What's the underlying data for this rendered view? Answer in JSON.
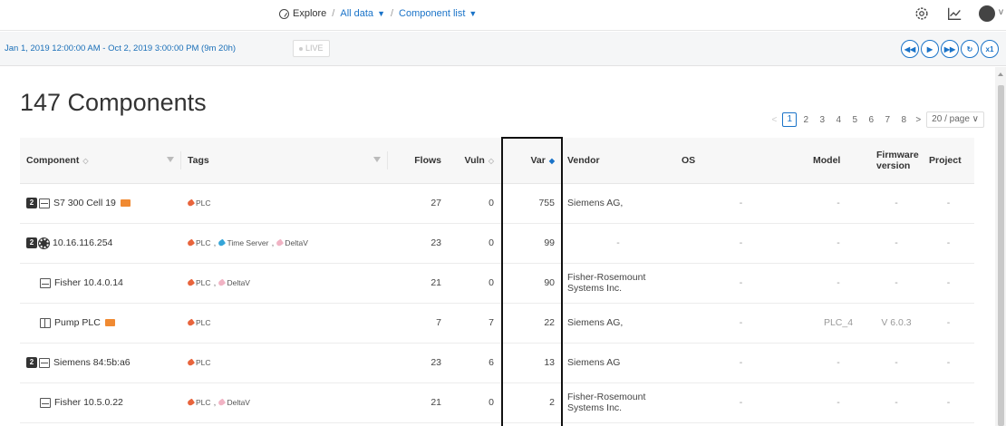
{
  "nav": {
    "explore": "Explore",
    "all_data": "All data",
    "component_list": "Component list"
  },
  "timebar": {
    "range": "Jan 1, 2019 12:00:00 AM - Oct 2, 2019 3:00:00 PM  (9m 20h)",
    "live": "LIVE",
    "playback": [
      "◀◀",
      "▶",
      "▶▶",
      "↻",
      "x1"
    ]
  },
  "title": "147 Components",
  "pagination": {
    "pages": [
      "1",
      "2",
      "3",
      "4",
      "5",
      "6",
      "7",
      "8"
    ],
    "active": "1",
    "prev": "<",
    "next": ">",
    "page_size": "20 / page"
  },
  "columns": {
    "component": "Component",
    "tags": "Tags",
    "flows": "Flows",
    "vuln": "Vuln",
    "var": "Var",
    "vendor": "Vendor",
    "os": "OS",
    "model": "Model",
    "firmware": "Firmware version",
    "project": "Project"
  },
  "colors": {
    "accent": "#1a73c8",
    "tag_plc": "#e8643c",
    "tag_time_server": "#35a5d8",
    "tag_deltav": "#f1b3c4",
    "warning": "#f08a32"
  },
  "rows": [
    {
      "badge": "2",
      "icon": "plc-icon",
      "name": "S7 300 Cell 19",
      "warn": true,
      "tags": [
        "PLC"
      ],
      "flows": "27",
      "vuln": "0",
      "var": "755",
      "vendor": "Siemens AG,",
      "os": "-",
      "model": "-",
      "firmware": "-",
      "project": "-",
      "sub": false
    },
    {
      "badge": "2",
      "icon": "gear-icon",
      "name": "10.16.116.254",
      "warn": false,
      "tags": [
        "PLC",
        "Time Server",
        "DeltaV"
      ],
      "flows": "23",
      "vuln": "0",
      "var": "99",
      "vendor": "-",
      "os": "-",
      "model": "-",
      "firmware": "-",
      "project": "-",
      "sub": false
    },
    {
      "badge": "",
      "icon": "pc-icon",
      "name": "Fisher 10.4.0.14",
      "warn": false,
      "tags": [
        "PLC",
        "DeltaV"
      ],
      "flows": "21",
      "vuln": "0",
      "var": "90",
      "vendor": "Fisher-Rosemount Systems Inc.",
      "os": "-",
      "model": "-",
      "firmware": "-",
      "project": "-",
      "sub": true
    },
    {
      "badge": "",
      "icon": "pump-icon",
      "name": "Pump PLC",
      "warn": true,
      "tags": [
        "PLC"
      ],
      "flows": "7",
      "vuln": "7",
      "var": "22",
      "vendor": "Siemens AG,",
      "os": "-",
      "model": "PLC_4",
      "firmware": "V 6.0.3",
      "project": "-",
      "sub": true
    },
    {
      "badge": "2",
      "icon": "plc-icon",
      "name": "Siemens 84:5b:a6",
      "warn": false,
      "tags": [
        "PLC"
      ],
      "flows": "23",
      "vuln": "6",
      "var": "13",
      "vendor": "Siemens AG",
      "os": "-",
      "model": "-",
      "firmware": "-",
      "project": "-",
      "sub": false
    },
    {
      "badge": "",
      "icon": "pc-icon",
      "name": "Fisher 10.5.0.22",
      "warn": false,
      "tags": [
        "PLC",
        "DeltaV"
      ],
      "flows": "21",
      "vuln": "0",
      "var": "2",
      "vendor": "Fisher-Rosemount Systems Inc.",
      "os": "-",
      "model": "-",
      "firmware": "-",
      "project": "-",
      "sub": true
    }
  ]
}
